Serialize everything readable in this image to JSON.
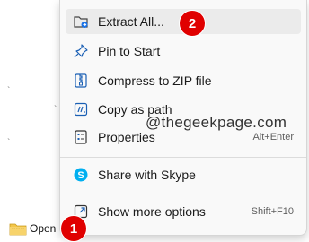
{
  "background": {
    "marks": [
      "`",
      "`",
      "`"
    ]
  },
  "menu": {
    "items": [
      {
        "label": "Extract All...",
        "icon": "extract-folder-icon",
        "shortcut": "",
        "highlighted": true
      },
      {
        "label": "Pin to Start",
        "icon": "pin-icon",
        "shortcut": ""
      },
      {
        "label": "Compress to ZIP file",
        "icon": "zip-icon",
        "shortcut": ""
      },
      {
        "label": "Copy as path",
        "icon": "copy-path-icon",
        "shortcut": ""
      },
      {
        "label": "Properties",
        "icon": "properties-icon",
        "shortcut": "Alt+Enter"
      },
      {
        "label": "Share with Skype",
        "icon": "skype-icon",
        "shortcut": ""
      },
      {
        "label": "Show more options",
        "icon": "more-options-icon",
        "shortcut": "Shift+F10"
      }
    ]
  },
  "watermark": "@thegeekpage.com",
  "badges": {
    "first": "1",
    "second": "2"
  },
  "open_item": {
    "label": "Open",
    "icon": "folder-icon"
  },
  "colors": {
    "badge": "#e00000",
    "menu_bg": "#f9f9f9",
    "highlight": "#ebebeb",
    "icon_blue": "#1a5fb4",
    "skype": "#00aff0"
  }
}
